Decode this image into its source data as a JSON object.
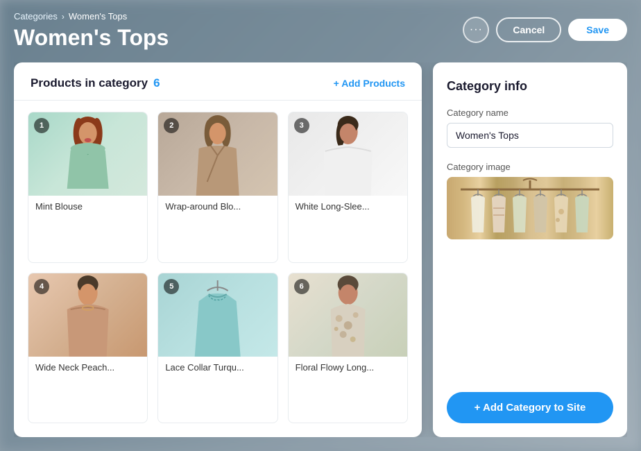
{
  "breadcrumb": {
    "parent_label": "Categories",
    "chevron": "›",
    "current_label": "Women's Tops"
  },
  "page_title": "Women's Tops",
  "header_actions": {
    "more_label": "···",
    "cancel_label": "Cancel",
    "save_label": "Save"
  },
  "products_section": {
    "title": "Products in category",
    "count": "6",
    "add_label": "+ Add Products",
    "products": [
      {
        "id": 1,
        "name": "Mint Blouse",
        "img_class": "img-mint",
        "badge": "1"
      },
      {
        "id": 2,
        "name": "Wrap-around Blo...",
        "img_class": "img-wrap",
        "badge": "2"
      },
      {
        "id": 3,
        "name": "White Long-Slee...",
        "img_class": "img-white",
        "badge": "3"
      },
      {
        "id": 4,
        "name": "Wide Neck Peach...",
        "img_class": "img-peach",
        "badge": "4"
      },
      {
        "id": 5,
        "name": "Lace Collar Turqu...",
        "img_class": "img-turq",
        "badge": "5"
      },
      {
        "id": 6,
        "name": "Floral Flowy Long...",
        "img_class": "img-floral",
        "badge": "6"
      }
    ]
  },
  "category_info": {
    "title": "Category info",
    "name_label": "Category name",
    "name_value": "Women's Tops",
    "image_label": "Category image",
    "add_btn_label": "+ Add Category to Site"
  }
}
